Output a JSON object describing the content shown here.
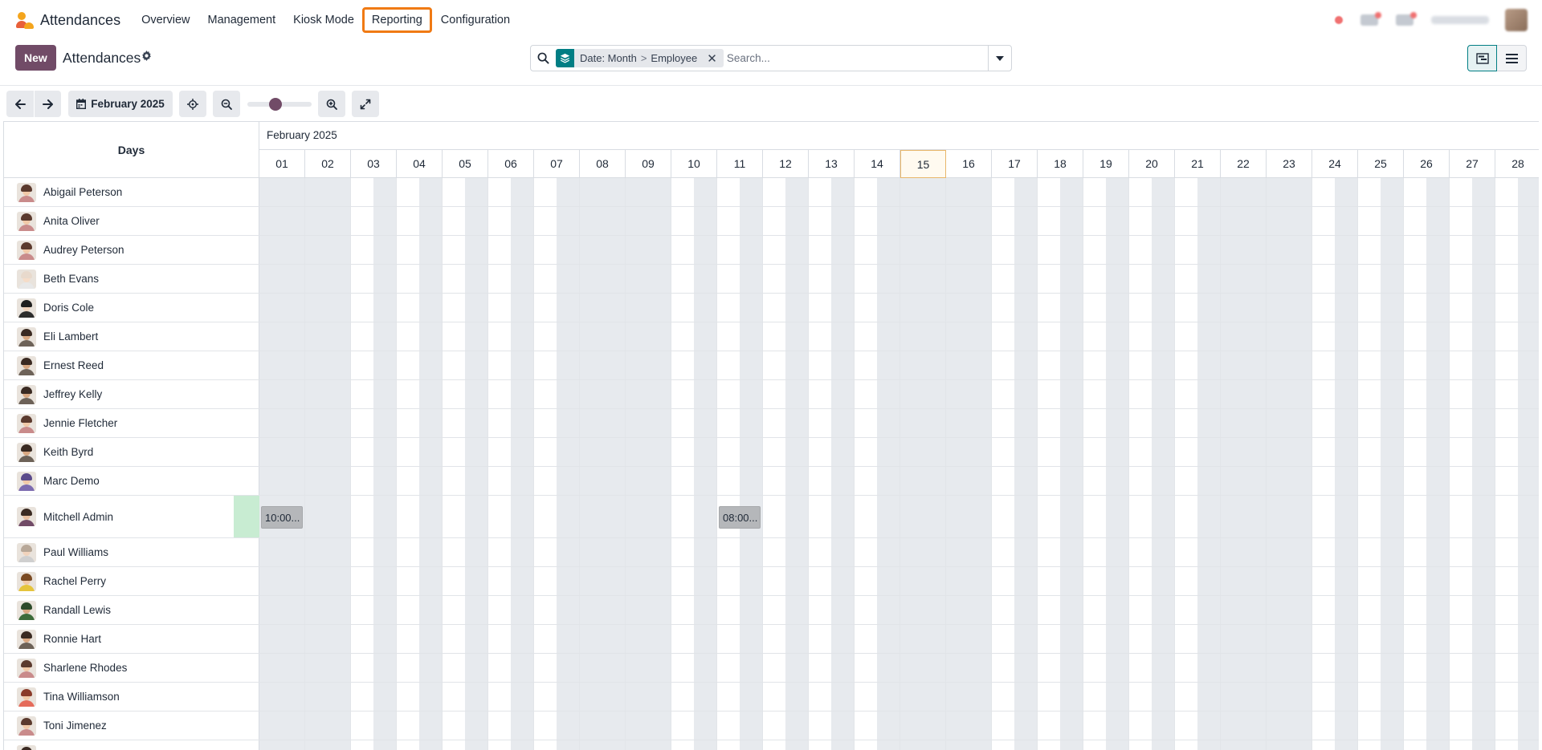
{
  "app": {
    "name": "Attendances"
  },
  "menu": [
    {
      "id": "overview",
      "label": "Overview"
    },
    {
      "id": "management",
      "label": "Management"
    },
    {
      "id": "kiosk",
      "label": "Kiosk Mode"
    },
    {
      "id": "reporting",
      "label": "Reporting"
    },
    {
      "id": "configuration",
      "label": "Configuration"
    }
  ],
  "control_panel": {
    "new_label": "New",
    "title": "Attendances"
  },
  "search": {
    "facet_group_1": "Date: Month",
    "facet_separator": ">",
    "facet_group_2": "Employee",
    "placeholder": "Search..."
  },
  "gantt_toolbar": {
    "period_label": "February 2025"
  },
  "gantt": {
    "rows_header": "Days",
    "month_label": "February 2025",
    "today": "15",
    "weekend_days": [
      "01",
      "02",
      "08",
      "09",
      "15",
      "16",
      "22",
      "23"
    ],
    "days": [
      "01",
      "02",
      "03",
      "04",
      "05",
      "06",
      "07",
      "08",
      "09",
      "10",
      "11",
      "12",
      "13",
      "14",
      "15",
      "16",
      "17",
      "18",
      "19",
      "20",
      "21",
      "22",
      "23",
      "24",
      "25",
      "26",
      "27",
      "28"
    ],
    "employees": [
      {
        "name": "Abigail Peterson",
        "avatar": "woman"
      },
      {
        "name": "Anita Oliver",
        "avatar": "woman"
      },
      {
        "name": "Audrey Peterson",
        "avatar": "woman"
      },
      {
        "name": "Beth Evans",
        "avatar": "woman-light"
      },
      {
        "name": "Doris Cole",
        "avatar": "woman-dark"
      },
      {
        "name": "Eli Lambert",
        "avatar": "man"
      },
      {
        "name": "Ernest Reed",
        "avatar": "man"
      },
      {
        "name": "Jeffrey Kelly",
        "avatar": "man"
      },
      {
        "name": "Jennie Fletcher",
        "avatar": "woman"
      },
      {
        "name": "Keith Byrd",
        "avatar": "man"
      },
      {
        "name": "Marc Demo",
        "avatar": "man-purple"
      },
      {
        "name": "Mitchell Admin",
        "avatar": "man-admin"
      },
      {
        "name": "Paul Williams",
        "avatar": "man-light"
      },
      {
        "name": "Rachel Perry",
        "avatar": "woman-yellow"
      },
      {
        "name": "Randall Lewis",
        "avatar": "man-green"
      },
      {
        "name": "Ronnie Hart",
        "avatar": "man"
      },
      {
        "name": "Sharlene Rhodes",
        "avatar": "woman"
      },
      {
        "name": "Tina Williamson",
        "avatar": "woman-red"
      },
      {
        "name": "Toni Jimenez",
        "avatar": "woman"
      },
      {
        "name": "",
        "avatar": "man"
      }
    ],
    "attendances": [
      {
        "employee": "Mitchell Admin",
        "day": "01",
        "label": "10:00..."
      },
      {
        "employee": "Mitchell Admin",
        "day": "11",
        "label": "08:00..."
      }
    ]
  },
  "colors": {
    "primary": "#714b67",
    "facet": "#017e84",
    "highlight": "#f07a14",
    "weekend": "#e7eaee",
    "pill": "#b5b7ba",
    "today_border": "#e8b66a"
  }
}
